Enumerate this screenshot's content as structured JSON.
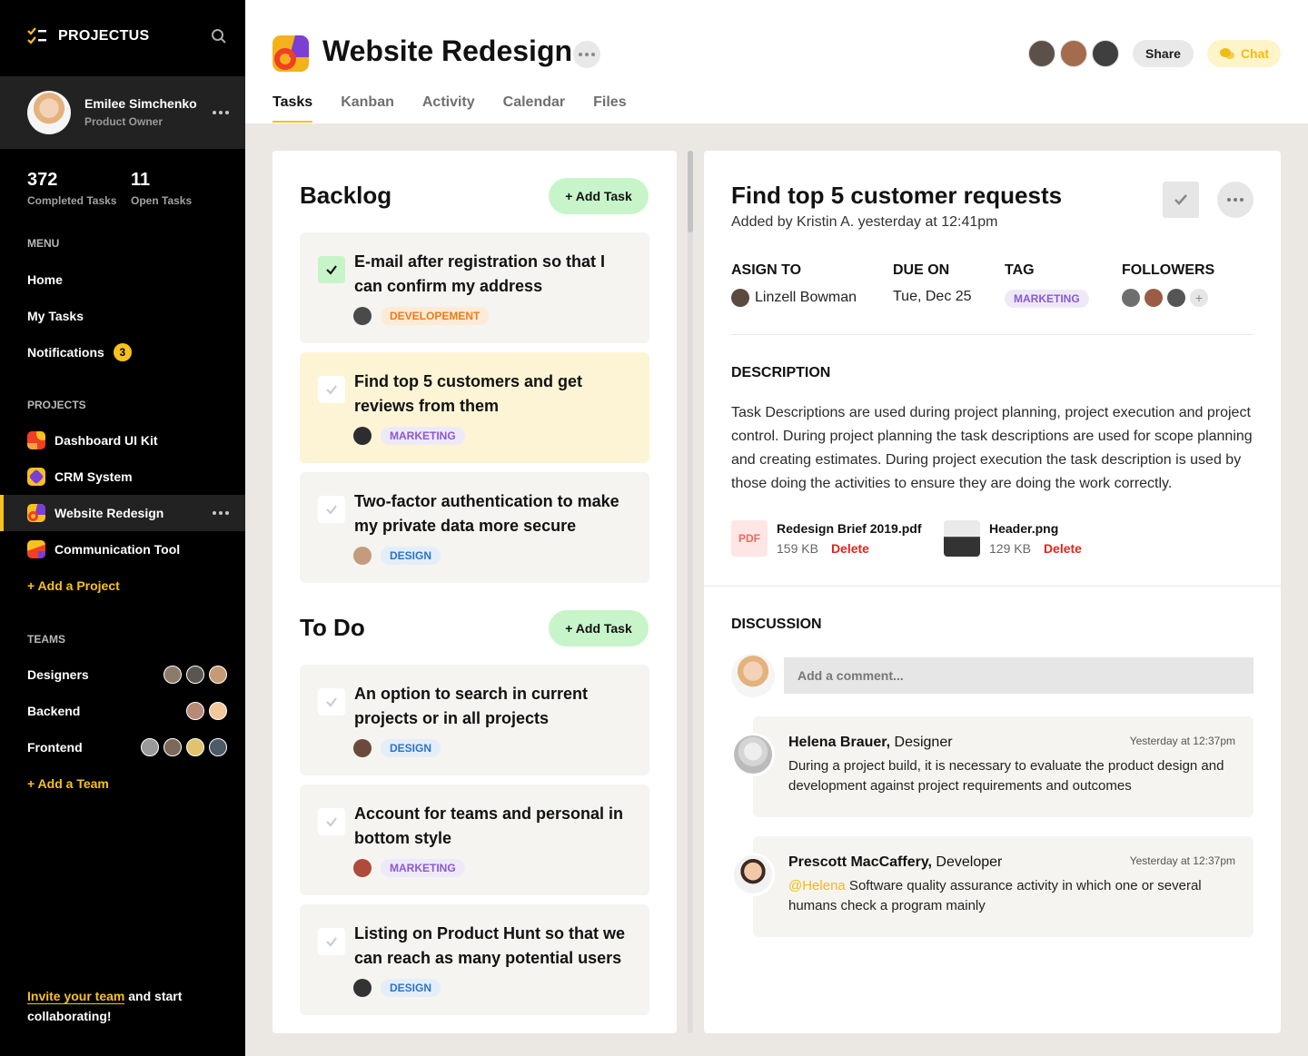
{
  "app": {
    "name": "PROJECTUS"
  },
  "user": {
    "name": "Emilee Simchenko",
    "role": "Product Owner"
  },
  "stats": [
    {
      "value": "372",
      "label": "Completed Tasks"
    },
    {
      "value": "11",
      "label": "Open Tasks"
    }
  ],
  "menu": {
    "heading": "MENU",
    "items": [
      "Home",
      "My Tasks",
      "Notifications"
    ],
    "notifications_count": "3"
  },
  "projects": {
    "heading": "PROJECTS",
    "items": [
      "Dashboard UI Kit",
      "CRM System",
      "Website Redesign",
      "Communication Tool"
    ],
    "add": "+ Add a Project"
  },
  "teams": {
    "heading": "TEAMS",
    "items": [
      "Designers",
      "Backend",
      "Frontend"
    ],
    "add": "+ Add a Team"
  },
  "invite": {
    "link": "Invite your team",
    "rest": " and start collaborating!"
  },
  "header": {
    "title": "Website Redesign",
    "tabs": [
      "Tasks",
      "Kanban",
      "Activity",
      "Calendar",
      "Files"
    ],
    "share": "Share",
    "chat": "Chat"
  },
  "board": {
    "backlog": {
      "title": "Backlog",
      "add": "+ Add Task",
      "cards": [
        {
          "title": "E-mail after registration so that I can confirm my address",
          "tag": "DEVELOPEMENT",
          "done": true
        },
        {
          "title": "Find top 5 customers and get reviews from them",
          "tag": "MARKETING",
          "highlighted": true
        },
        {
          "title": "Two-factor authentication to make my private data more secure",
          "tag": "DESIGN"
        }
      ]
    },
    "todo": {
      "title": "To Do",
      "add": "+ Add Task",
      "cards": [
        {
          "title": "An option to search in current projects or in all projects",
          "tag": "DESIGN"
        },
        {
          "title": "Account for teams and personal in bottom style",
          "tag": "MARKETING"
        },
        {
          "title": "Listing on Product Hunt so that we can reach as many potential users",
          "tag": "DESIGN"
        }
      ]
    }
  },
  "detail": {
    "title": "Find top 5 customer requests",
    "subtitle": "Added by Kristin A. yesterday at 12:41pm",
    "assign_label": "ASIGN TO",
    "assign_value": "Linzell Bowman",
    "due_label": "DUE ON",
    "due_value": "Tue, Dec 25",
    "tag_label": "TAG",
    "tag_value": "MARKETING",
    "followers_label": "FOLLOWERS",
    "description_label": "DESCRIPTION",
    "description": "Task Descriptions are used during project planning, project execution and project control. During project planning the task descriptions are used for scope planning and creating estimates. During project execution the task description is used by those doing the activities to ensure they are doing the work correctly.",
    "files": [
      {
        "icon": "PDF",
        "name": "Redesign Brief 2019.pdf",
        "size": "159 KB",
        "action": "Delete"
      },
      {
        "name": "Header.png",
        "size": "129 KB",
        "action": "Delete"
      }
    ],
    "discussion_label": "DISCUSSION",
    "comment_placeholder": "Add a comment...",
    "comments": [
      {
        "name": "Helena Brauer,",
        "role": " Designer",
        "time": "Yesterday at 12:37pm",
        "text": "During a project build, it is necessary to evaluate the product design and development against project requirements and outcomes"
      },
      {
        "name": "Prescott MacCaffery,",
        "role": " Developer",
        "time": "Yesterday at 12:37pm",
        "mention": "@Helena",
        "text": " Software quality assurance activity in which one or several humans check a program mainly"
      }
    ]
  },
  "colors": {
    "accent": "#f7c11e",
    "sidebar": "#000000",
    "green": "#c7f5c9",
    "delete": "#e3241b"
  }
}
